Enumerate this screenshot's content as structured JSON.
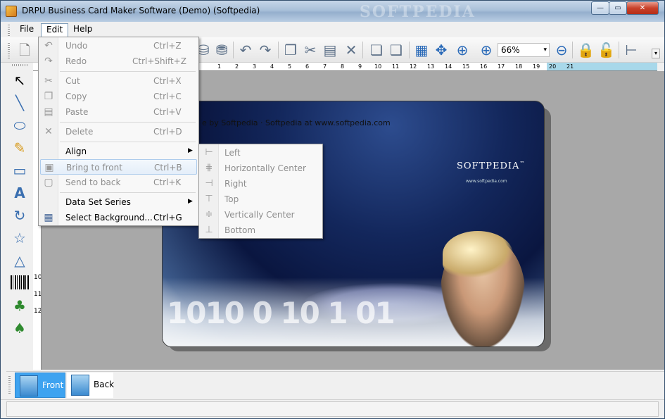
{
  "window": {
    "title": "DRPU Business Card Maker Software (Demo) (Softpedia)",
    "watermark": "SOFTPEDIA",
    "controls": {
      "minimize": "—",
      "maximize": "▭",
      "close": "✕"
    }
  },
  "menubar": {
    "file": "File",
    "edit": "Edit",
    "help": "Help"
  },
  "toolbar": {
    "zoom": "66%",
    "zoom_arrow": "▾",
    "overflow": "▾",
    "icons": [
      "new-icon",
      "open-icon",
      "database-add-icon",
      "database-icon",
      "undo-icon",
      "redo-icon",
      "copy-icon",
      "cut-icon",
      "paste-icon",
      "delete-icon",
      "bring-front-icon",
      "send-back-icon",
      "grid-icon",
      "center-icon",
      "fit-icon",
      "zoom-in-icon",
      "zoom-out-icon",
      "lock-icon",
      "unlock-icon",
      "align-left-icon"
    ]
  },
  "ruler": {
    "h": [
      "1",
      "2",
      "3",
      "4",
      "5",
      "6",
      "7",
      "8",
      "9",
      "10",
      "11",
      "12",
      "13",
      "14",
      "15",
      "16",
      "17",
      "18",
      "19",
      "20",
      "21"
    ],
    "v": [
      "10",
      "11",
      "12"
    ]
  },
  "edit_menu": {
    "items": [
      {
        "label": "Undo",
        "shortcut": "Ctrl+Z",
        "icon": "↶"
      },
      {
        "label": "Redo",
        "shortcut": "Ctrl+Shift+Z",
        "icon": "↷"
      },
      {
        "label": "Cut",
        "shortcut": "Ctrl+X",
        "icon": "✂"
      },
      {
        "label": "Copy",
        "shortcut": "Ctrl+C",
        "icon": "❐"
      },
      {
        "label": "Paste",
        "shortcut": "Ctrl+V",
        "icon": "▤"
      },
      {
        "label": "Delete",
        "shortcut": "Ctrl+D",
        "icon": "✕"
      },
      {
        "label": "Align",
        "shortcut": "",
        "icon": "",
        "arrow": "▶"
      },
      {
        "label": "Bring to front",
        "shortcut": "Ctrl+B",
        "icon": "▣"
      },
      {
        "label": "Send to back",
        "shortcut": "Ctrl+K",
        "icon": "▢"
      },
      {
        "label": "Data Set Series",
        "shortcut": "",
        "icon": "",
        "arrow": "▶"
      },
      {
        "label": "Select Background...",
        "shortcut": "Ctrl+G",
        "icon": "▦"
      }
    ]
  },
  "align_menu": {
    "items": [
      {
        "label": "Left",
        "icon": "⊢"
      },
      {
        "label": "Horizontally Center",
        "icon": "⋕"
      },
      {
        "label": "Right",
        "icon": "⊣"
      },
      {
        "label": "Top",
        "icon": "⊤"
      },
      {
        "label": "Vertically Center",
        "icon": "≑"
      },
      {
        "label": "Bottom",
        "icon": "⊥"
      }
    ]
  },
  "card": {
    "text": "e by Softpedia · Softpedia at www.softpedia.com",
    "logo": "SOFTPEDIA",
    "logo_tm": "™",
    "url": "www.softpedia.com",
    "digits": "1010 0 10 1 01"
  },
  "pages": {
    "front": "Front",
    "back": "Back"
  },
  "tools": [
    "↖",
    "╲",
    "⬭",
    "✎",
    "▭",
    "A",
    "↻",
    "☆",
    "△",
    "▮",
    "♣",
    "♠"
  ]
}
